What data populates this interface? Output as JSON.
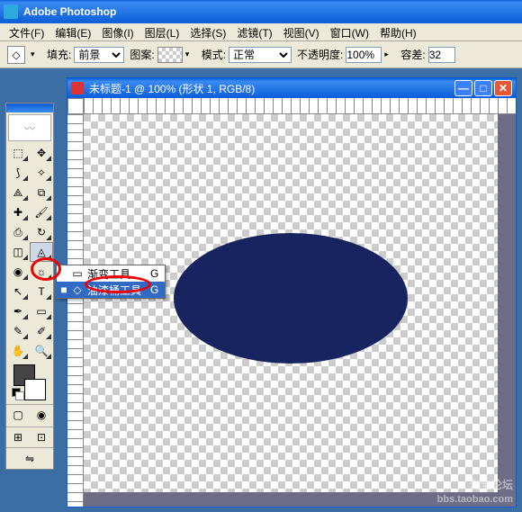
{
  "app": {
    "title": "Adobe Photoshop"
  },
  "menu": [
    "文件(F)",
    "编辑(E)",
    "图像(I)",
    "图层(L)",
    "选择(S)",
    "滤镜(T)",
    "视图(V)",
    "窗口(W)",
    "帮助(H)"
  ],
  "options": {
    "fill_label": "填充:",
    "fill_value": "前景",
    "pattern_label": "图案:",
    "mode_label": "模式:",
    "mode_value": "正常",
    "opacity_label": "不透明度:",
    "opacity_value": "100%",
    "tolerance_label": "容差:",
    "tolerance_value": "32"
  },
  "doc": {
    "title": "未标题-1 @ 100% (形状 1, RGB/8)"
  },
  "flyout": {
    "items": [
      {
        "mark": "",
        "icon": "▭",
        "label": "渐变工具",
        "key": "G"
      },
      {
        "mark": "■",
        "icon": "◇",
        "label": "油漆桶工具",
        "key": "G"
      }
    ],
    "selected": 1
  },
  "tools": [
    "marquee",
    "move",
    "lasso",
    "wand",
    "crop",
    "slice",
    "healing",
    "brush",
    "stamp",
    "history-brush",
    "eraser",
    "paint-bucket",
    "blur",
    "dodge",
    "path-select",
    "type",
    "pen",
    "shape",
    "notes",
    "eyedropper",
    "hand",
    "zoom"
  ],
  "tool_glyphs": [
    "⬚",
    "✥",
    "⟆",
    "✧",
    "⟁",
    "⧉",
    "✚",
    "🖌",
    "⎙",
    "↻",
    "◫",
    "◬",
    "◉",
    "☼",
    "↖",
    "T",
    "✒",
    "▭",
    "✎",
    "✐",
    "✋",
    "🔍"
  ],
  "watermark": {
    "main": "淘宝论坛",
    "sub": "bbs.taobao.com"
  }
}
